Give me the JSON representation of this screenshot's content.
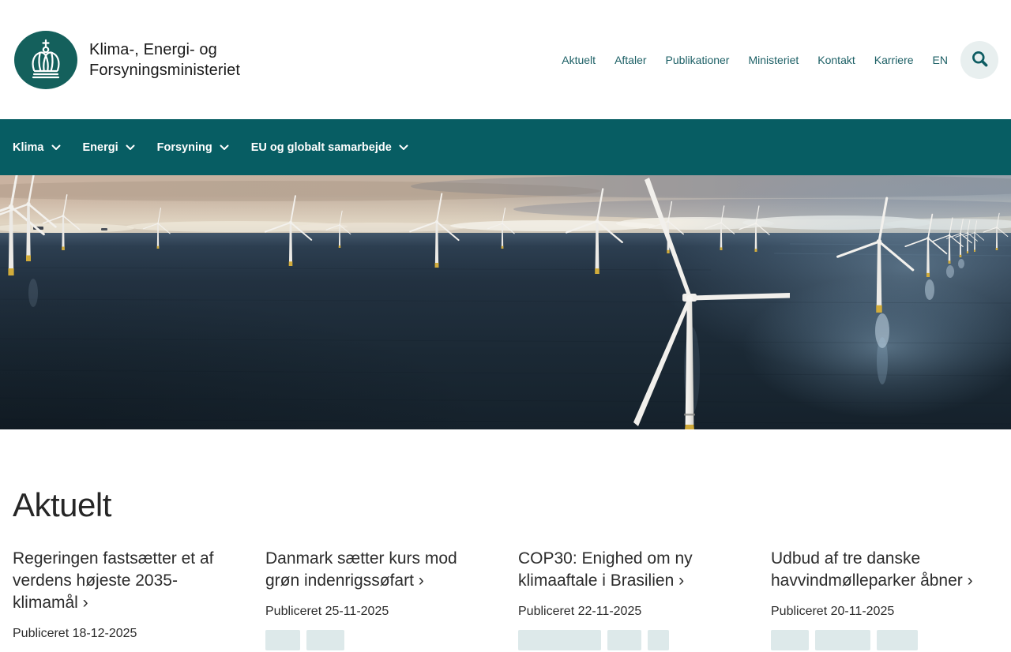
{
  "brand": {
    "logo_icon": "crown-icon",
    "name_line1": "Klima-, Energi- og",
    "name_line2": "Forsyningsministeriet"
  },
  "header_nav": {
    "items": [
      "Aktuelt",
      "Aftaler",
      "Publikationer",
      "Ministeriet",
      "Kontakt",
      "Karriere",
      "EN"
    ],
    "search_icon": "search-icon"
  },
  "main_nav": {
    "items": [
      {
        "label": "Klima",
        "icon": "chevron-down-icon"
      },
      {
        "label": "Energi",
        "icon": "chevron-down-icon"
      },
      {
        "label": "Forsyning",
        "icon": "chevron-down-icon"
      },
      {
        "label": "EU og globalt samarbejde",
        "icon": "chevron-down-icon"
      }
    ]
  },
  "hero": {
    "image": "offshore-wind-turbines-photo"
  },
  "section": {
    "title": "Aktuelt"
  },
  "cards": [
    {
      "title": "Regeringen fastsætter et af verdens højeste 2035-klimamål ›",
      "published": "Publiceret 18-12-2025",
      "tag_widths": []
    },
    {
      "title": "Danmark sætter kurs mod grøn indenrigssøfart ›",
      "published": "Publiceret 25-11-2025",
      "tag_widths": [
        44,
        48
      ]
    },
    {
      "title": "COP30: Enighed om ny klimaaftale i Brasilien ›",
      "published": "Publiceret 22-11-2025",
      "tag_widths": [
        105,
        43,
        27
      ]
    },
    {
      "title": "Udbud af tre danske havvindmølleparker åbner ›",
      "published": "Publiceret 20-11-2025",
      "tag_widths": [
        48,
        70,
        52
      ]
    }
  ],
  "colors": {
    "nav_teal": "#075d63",
    "logo_teal": "#14605c",
    "link_teal": "#1d6066",
    "search_circle_bg": "#e8efef",
    "tag_chip_bg": "#dde9ea",
    "text_dark": "#2c2c2c"
  }
}
